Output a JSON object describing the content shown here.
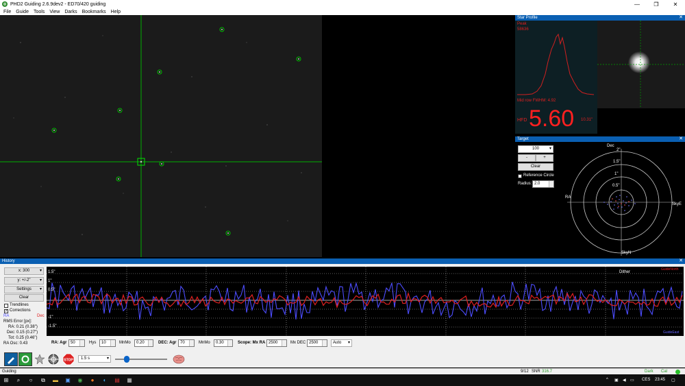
{
  "window": {
    "title": "PHD2 Guiding 2.6.9dev2 - ED70/420 guiding",
    "app_icon": "phd2-logo-icon"
  },
  "menu": [
    "File",
    "Guide",
    "Tools",
    "View",
    "Darks",
    "Bookmarks",
    "Help"
  ],
  "star_profile": {
    "title": "Star Profile",
    "peak_label": "Peak",
    "peak_value": "58636",
    "fwhm": "Mid row FWHM: 4.92",
    "hfd_label": "HFD",
    "hfd_value": "5.60",
    "hfd_arcsec": "10.31\""
  },
  "target": {
    "title": "Target",
    "zoom": "100",
    "minus": "-",
    "plus": "+",
    "clear": "Clear",
    "ref_circle": "Reference Circle",
    "radius_label": "Radius:",
    "radius_value": "2.0",
    "labels": {
      "dec": "Dec",
      "ra": "RA",
      "skye": "SkyE",
      "skyn": "SkyN",
      "r2": "2\"",
      "r15": "1.5\"",
      "r1": "1\"",
      "r05": "0.5\""
    }
  },
  "history": {
    "title": "History",
    "xscale": "x: 300",
    "yscale": "y: +/-2\"",
    "settings": "Settings",
    "clear": "Clear",
    "trendlines": "Trendlines",
    "corrections": "Corrections",
    "ra_legend": "RA",
    "dec_legend": "Dec",
    "rms_title": "RMS Error [px]:",
    "rms_ra": "RA: 0.21 (0.38\")",
    "rms_dec": "Dec: 0.15 (0.27\")",
    "rms_tot": "Tot: 0.25 (0.46\")",
    "ra_osc": "RA Osc: 0.43",
    "y_labels": [
      "1.5\"",
      "1\"",
      "0.5\"",
      "-1\"",
      "-1.5\""
    ],
    "dither": "Dither",
    "guide_north": "GuideNorth",
    "guide_east": "GuideEast"
  },
  "params": {
    "ra_agr_label": "RA: Agr",
    "ra_agr": "50",
    "hys_label": "Hys",
    "hys": "10",
    "mnmo_label": "MnMo",
    "ra_mnmo": "0.20",
    "dec_agr_label": "DEC: Agr",
    "dec_agr": "70",
    "dec_mnmo": "0.30",
    "scope_mxra_label": "Scope: Mx RA",
    "mx_ra": "2500",
    "mx_dec_label": "Mx DEC",
    "mx_dec": "2500",
    "dec_mode": "Auto"
  },
  "toolbar": {
    "exposure": "1.5 s"
  },
  "status": {
    "state": "Guiding",
    "frame": "9/12",
    "snr_label": "SNR",
    "snr": "316.7",
    "dark": "Dark",
    "cal": "Cal"
  },
  "taskbar": {
    "lang": "CES",
    "time": "23:45"
  },
  "colors": {
    "accent": "#0a5fb2",
    "ra": "#4d4dff",
    "dec": "#e02020",
    "crosshair": "#00c000"
  }
}
